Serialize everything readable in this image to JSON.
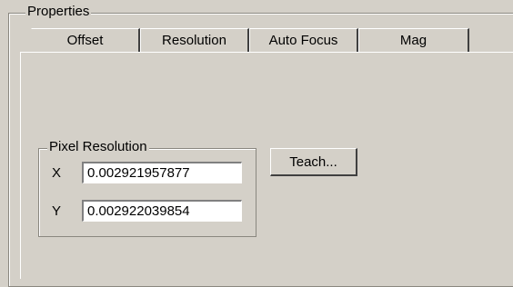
{
  "properties": {
    "group_label": "Properties"
  },
  "tabs": [
    {
      "label": "Offset"
    },
    {
      "label": "Resolution"
    },
    {
      "label": "Auto Focus"
    },
    {
      "label": "Mag"
    }
  ],
  "pixel_resolution": {
    "group_label": "Pixel Resolution",
    "x_label": "X",
    "x_value": "0.002921957877",
    "y_label": "Y",
    "y_value": "0.002922039854"
  },
  "teach_button": {
    "label": "Teach..."
  }
}
